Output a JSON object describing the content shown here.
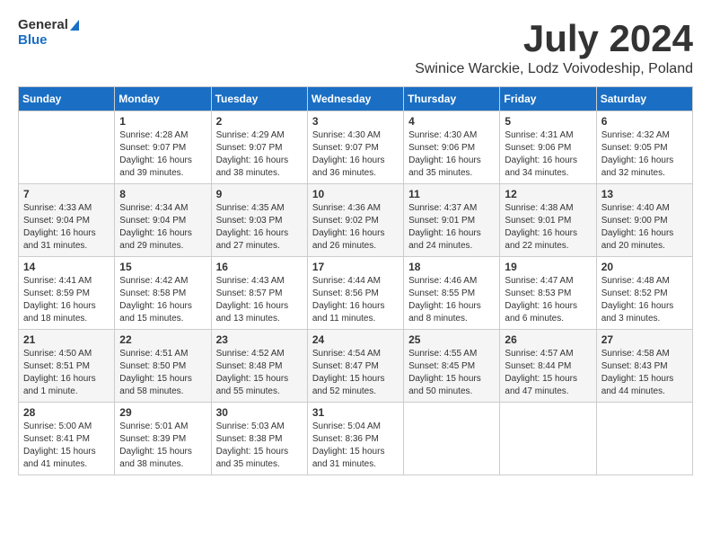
{
  "logo": {
    "general": "General",
    "blue": "Blue"
  },
  "title": "July 2024",
  "location": "Swinice Warckie, Lodz Voivodeship, Poland",
  "days_of_week": [
    "Sunday",
    "Monday",
    "Tuesday",
    "Wednesday",
    "Thursday",
    "Friday",
    "Saturday"
  ],
  "weeks": [
    [
      {
        "day": "",
        "info": ""
      },
      {
        "day": "1",
        "info": "Sunrise: 4:28 AM\nSunset: 9:07 PM\nDaylight: 16 hours\nand 39 minutes."
      },
      {
        "day": "2",
        "info": "Sunrise: 4:29 AM\nSunset: 9:07 PM\nDaylight: 16 hours\nand 38 minutes."
      },
      {
        "day": "3",
        "info": "Sunrise: 4:30 AM\nSunset: 9:07 PM\nDaylight: 16 hours\nand 36 minutes."
      },
      {
        "day": "4",
        "info": "Sunrise: 4:30 AM\nSunset: 9:06 PM\nDaylight: 16 hours\nand 35 minutes."
      },
      {
        "day": "5",
        "info": "Sunrise: 4:31 AM\nSunset: 9:06 PM\nDaylight: 16 hours\nand 34 minutes."
      },
      {
        "day": "6",
        "info": "Sunrise: 4:32 AM\nSunset: 9:05 PM\nDaylight: 16 hours\nand 32 minutes."
      }
    ],
    [
      {
        "day": "7",
        "info": "Sunrise: 4:33 AM\nSunset: 9:04 PM\nDaylight: 16 hours\nand 31 minutes."
      },
      {
        "day": "8",
        "info": "Sunrise: 4:34 AM\nSunset: 9:04 PM\nDaylight: 16 hours\nand 29 minutes."
      },
      {
        "day": "9",
        "info": "Sunrise: 4:35 AM\nSunset: 9:03 PM\nDaylight: 16 hours\nand 27 minutes."
      },
      {
        "day": "10",
        "info": "Sunrise: 4:36 AM\nSunset: 9:02 PM\nDaylight: 16 hours\nand 26 minutes."
      },
      {
        "day": "11",
        "info": "Sunrise: 4:37 AM\nSunset: 9:01 PM\nDaylight: 16 hours\nand 24 minutes."
      },
      {
        "day": "12",
        "info": "Sunrise: 4:38 AM\nSunset: 9:01 PM\nDaylight: 16 hours\nand 22 minutes."
      },
      {
        "day": "13",
        "info": "Sunrise: 4:40 AM\nSunset: 9:00 PM\nDaylight: 16 hours\nand 20 minutes."
      }
    ],
    [
      {
        "day": "14",
        "info": "Sunrise: 4:41 AM\nSunset: 8:59 PM\nDaylight: 16 hours\nand 18 minutes."
      },
      {
        "day": "15",
        "info": "Sunrise: 4:42 AM\nSunset: 8:58 PM\nDaylight: 16 hours\nand 15 minutes."
      },
      {
        "day": "16",
        "info": "Sunrise: 4:43 AM\nSunset: 8:57 PM\nDaylight: 16 hours\nand 13 minutes."
      },
      {
        "day": "17",
        "info": "Sunrise: 4:44 AM\nSunset: 8:56 PM\nDaylight: 16 hours\nand 11 minutes."
      },
      {
        "day": "18",
        "info": "Sunrise: 4:46 AM\nSunset: 8:55 PM\nDaylight: 16 hours\nand 8 minutes."
      },
      {
        "day": "19",
        "info": "Sunrise: 4:47 AM\nSunset: 8:53 PM\nDaylight: 16 hours\nand 6 minutes."
      },
      {
        "day": "20",
        "info": "Sunrise: 4:48 AM\nSunset: 8:52 PM\nDaylight: 16 hours\nand 3 minutes."
      }
    ],
    [
      {
        "day": "21",
        "info": "Sunrise: 4:50 AM\nSunset: 8:51 PM\nDaylight: 16 hours\nand 1 minute."
      },
      {
        "day": "22",
        "info": "Sunrise: 4:51 AM\nSunset: 8:50 PM\nDaylight: 15 hours\nand 58 minutes."
      },
      {
        "day": "23",
        "info": "Sunrise: 4:52 AM\nSunset: 8:48 PM\nDaylight: 15 hours\nand 55 minutes."
      },
      {
        "day": "24",
        "info": "Sunrise: 4:54 AM\nSunset: 8:47 PM\nDaylight: 15 hours\nand 52 minutes."
      },
      {
        "day": "25",
        "info": "Sunrise: 4:55 AM\nSunset: 8:45 PM\nDaylight: 15 hours\nand 50 minutes."
      },
      {
        "day": "26",
        "info": "Sunrise: 4:57 AM\nSunset: 8:44 PM\nDaylight: 15 hours\nand 47 minutes."
      },
      {
        "day": "27",
        "info": "Sunrise: 4:58 AM\nSunset: 8:43 PM\nDaylight: 15 hours\nand 44 minutes."
      }
    ],
    [
      {
        "day": "28",
        "info": "Sunrise: 5:00 AM\nSunset: 8:41 PM\nDaylight: 15 hours\nand 41 minutes."
      },
      {
        "day": "29",
        "info": "Sunrise: 5:01 AM\nSunset: 8:39 PM\nDaylight: 15 hours\nand 38 minutes."
      },
      {
        "day": "30",
        "info": "Sunrise: 5:03 AM\nSunset: 8:38 PM\nDaylight: 15 hours\nand 35 minutes."
      },
      {
        "day": "31",
        "info": "Sunrise: 5:04 AM\nSunset: 8:36 PM\nDaylight: 15 hours\nand 31 minutes."
      },
      {
        "day": "",
        "info": ""
      },
      {
        "day": "",
        "info": ""
      },
      {
        "day": "",
        "info": ""
      }
    ]
  ]
}
